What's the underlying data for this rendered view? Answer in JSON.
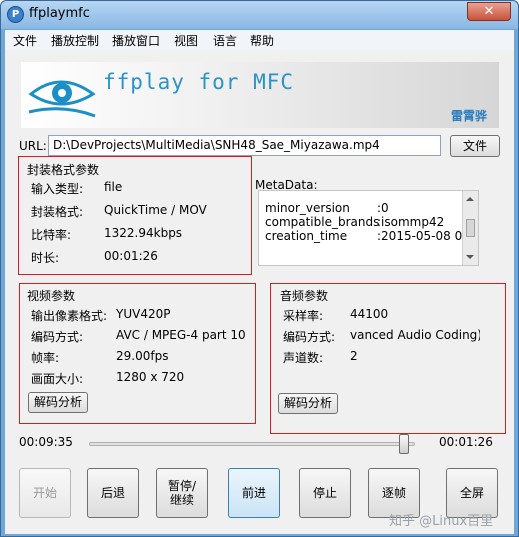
{
  "window": {
    "title": "ffplaymfc",
    "icon_glyph": "P",
    "close_glyph": "✕"
  },
  "menu": {
    "items": [
      "文件",
      "播放控制",
      "播放窗口",
      "视图",
      "语言",
      "帮助"
    ]
  },
  "banner": {
    "title": "ffplay for MFC",
    "author": "雷霄骅"
  },
  "url": {
    "label": "URL:",
    "value": "D:\\DevProjects\\MultiMedia\\SNH48_Sae_Miyazawa.mp4",
    "browse_label": "文件"
  },
  "container": {
    "title": "封装格式参数",
    "rows": [
      {
        "label": "输入类型:",
        "value": "file"
      },
      {
        "label": "封装格式:",
        "value": "QuickTime / MOV"
      },
      {
        "label": "比特率:",
        "value": "1322.94kbps"
      },
      {
        "label": "时长:",
        "value": "00:01:26"
      }
    ]
  },
  "metadata": {
    "title": "MetaData:",
    "rows": [
      {
        "key": "minor_version",
        "value": ":0"
      },
      {
        "key": "compatible_brands",
        "value": ":isommp42"
      },
      {
        "key": "creation_time",
        "value": ":2015-05-08 0"
      }
    ]
  },
  "video": {
    "title": "视频参数",
    "rows": [
      {
        "label": "输出像素格式:",
        "value": "YUV420P"
      },
      {
        "label": "编码方式:",
        "value": "AVC / MPEG-4 part 10"
      },
      {
        "label": "帧率:",
        "value": "29.00fps"
      },
      {
        "label": "画面大小:",
        "value": "1280 x 720"
      }
    ],
    "analyze_label": "解码分析"
  },
  "audio": {
    "title": "音频参数",
    "rows": [
      {
        "label": "采样率:",
        "value": "44100"
      },
      {
        "label": "编码方式:",
        "value": "vanced Audio Coding)"
      },
      {
        "label": "声道数:",
        "value": "2"
      }
    ],
    "analyze_label": "解码分析"
  },
  "timeline": {
    "current": "00:09:35",
    "total": "00:01:26",
    "position_fraction": 0.99
  },
  "controls": {
    "start": "开始",
    "back": "后退",
    "pause_line1": "暂停/",
    "pause_line2": "继续",
    "forward": "前进",
    "stop": "停止",
    "frame": "逐帧",
    "fullscreen": "全屏"
  },
  "watermark": "知乎 @Linux百里"
}
